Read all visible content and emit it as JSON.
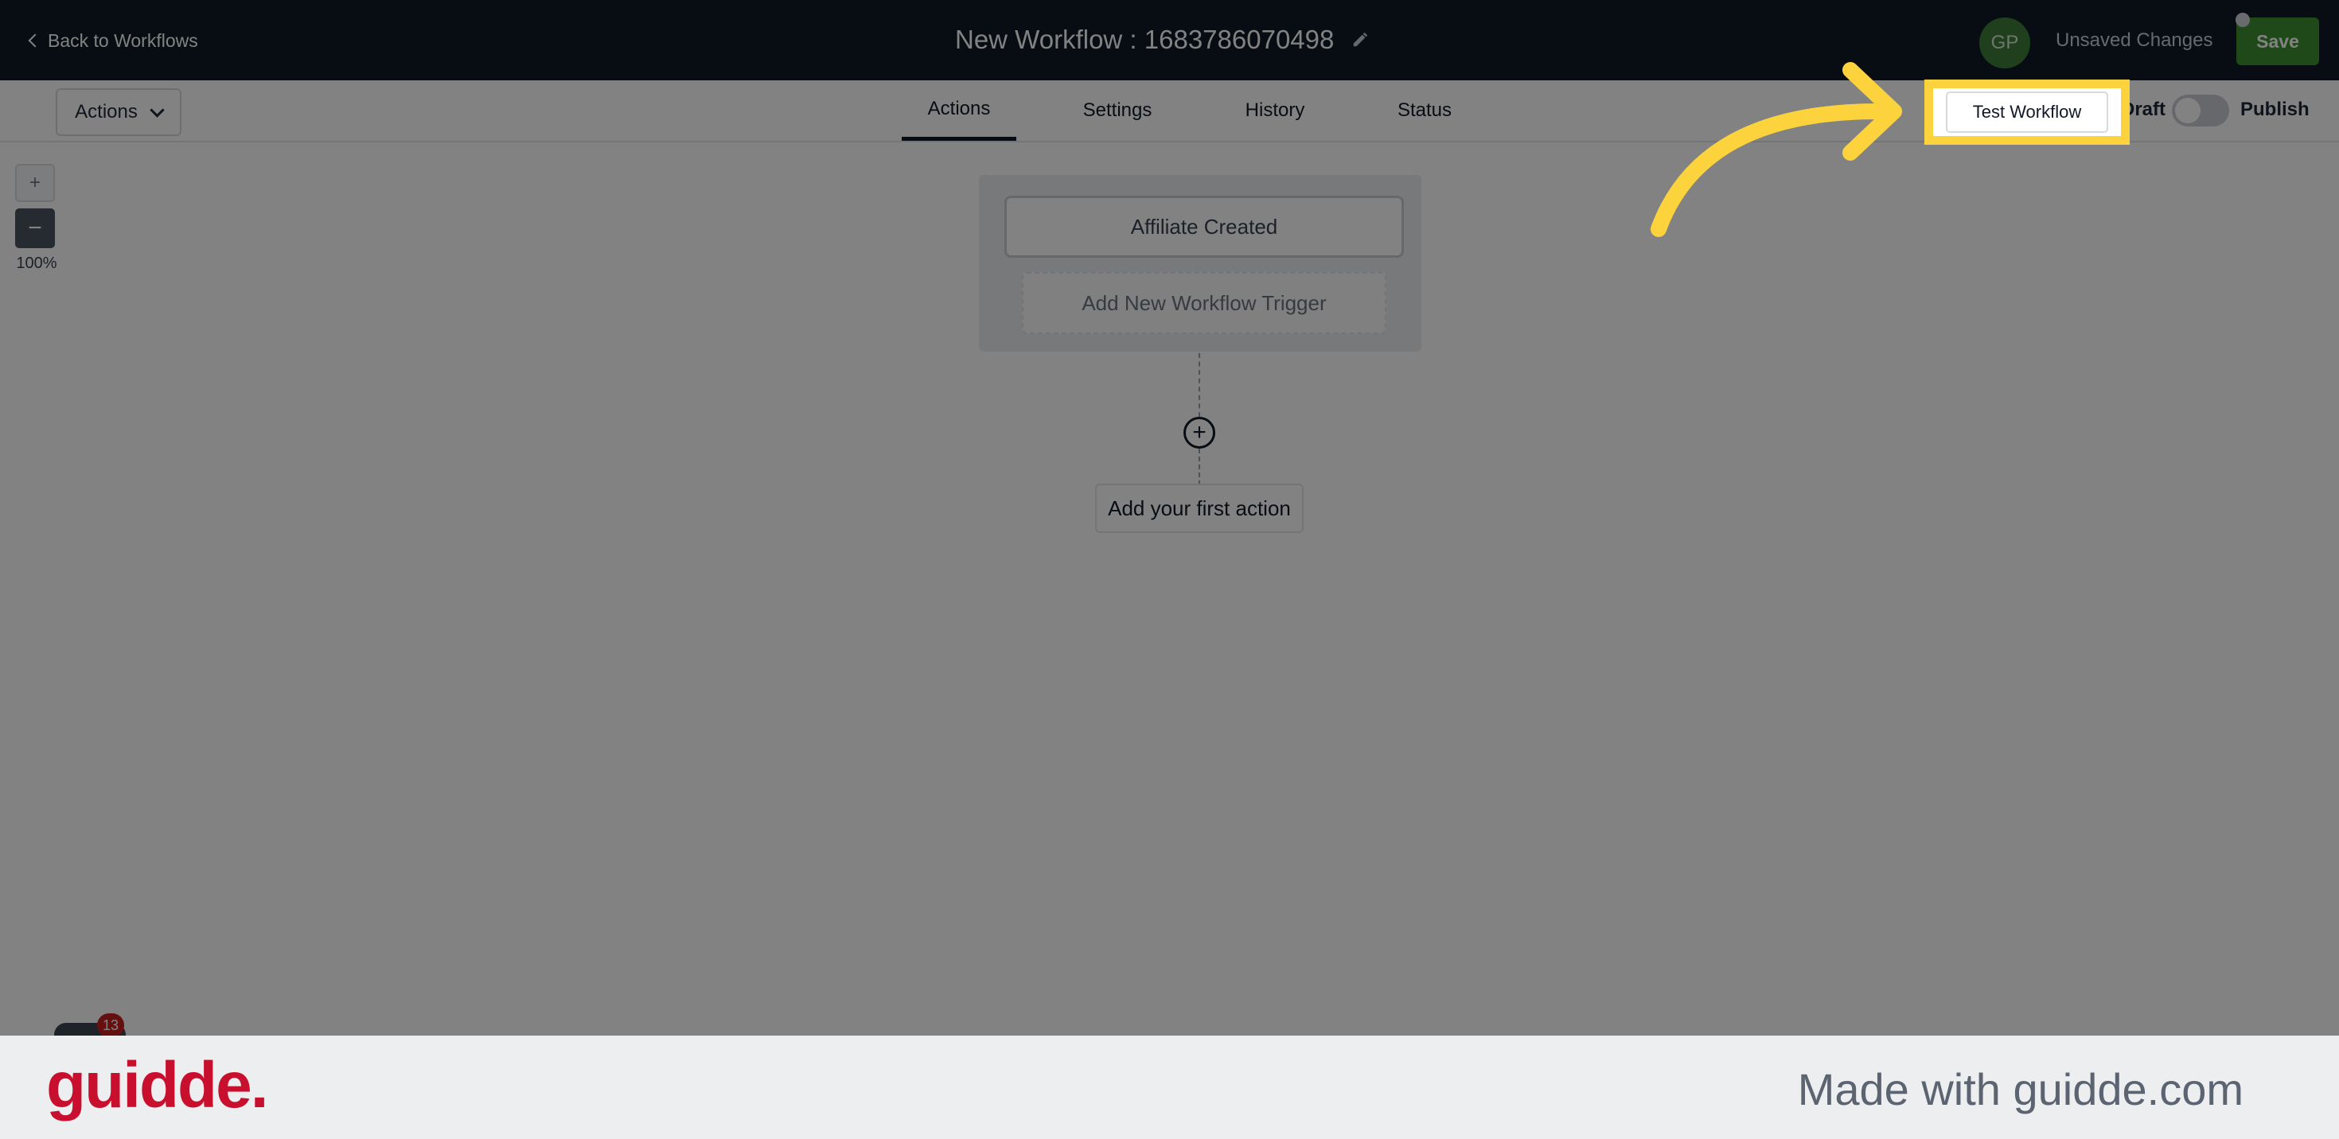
{
  "topbar": {
    "back_label": "Back to Workflows",
    "title": "New Workflow : 1683786070498",
    "avatar_initials": "GP",
    "unsaved_label": "Unsaved Changes",
    "save_label": "Save"
  },
  "toolbar": {
    "actions_dropdown": "Actions",
    "tabs": [
      {
        "label": "Actions",
        "active": true
      },
      {
        "label": "Settings",
        "active": false
      },
      {
        "label": "History",
        "active": false
      },
      {
        "label": "Status",
        "active": false
      }
    ],
    "test_workflow_label": "Test Workflow",
    "draft_label": "Draft",
    "publish_label": "Publish",
    "publish_toggle_on": false
  },
  "canvas": {
    "zoom_in": "+",
    "zoom_out": "−",
    "zoom_level": "100%",
    "trigger_label": "Affiliate Created",
    "add_trigger_label": "Add New Workflow Trigger",
    "add_action_symbol": "+",
    "first_action_label": "Add your first action",
    "chat_badge_count": "13"
  },
  "footer": {
    "logo_text": "guidde.",
    "made_with": "Made with guidde.com"
  },
  "colors": {
    "navbar": "#0f1a24",
    "save_green": "#3e8f2f",
    "highlight_yellow": "#fcd33d",
    "logo_red": "#c8102e"
  }
}
